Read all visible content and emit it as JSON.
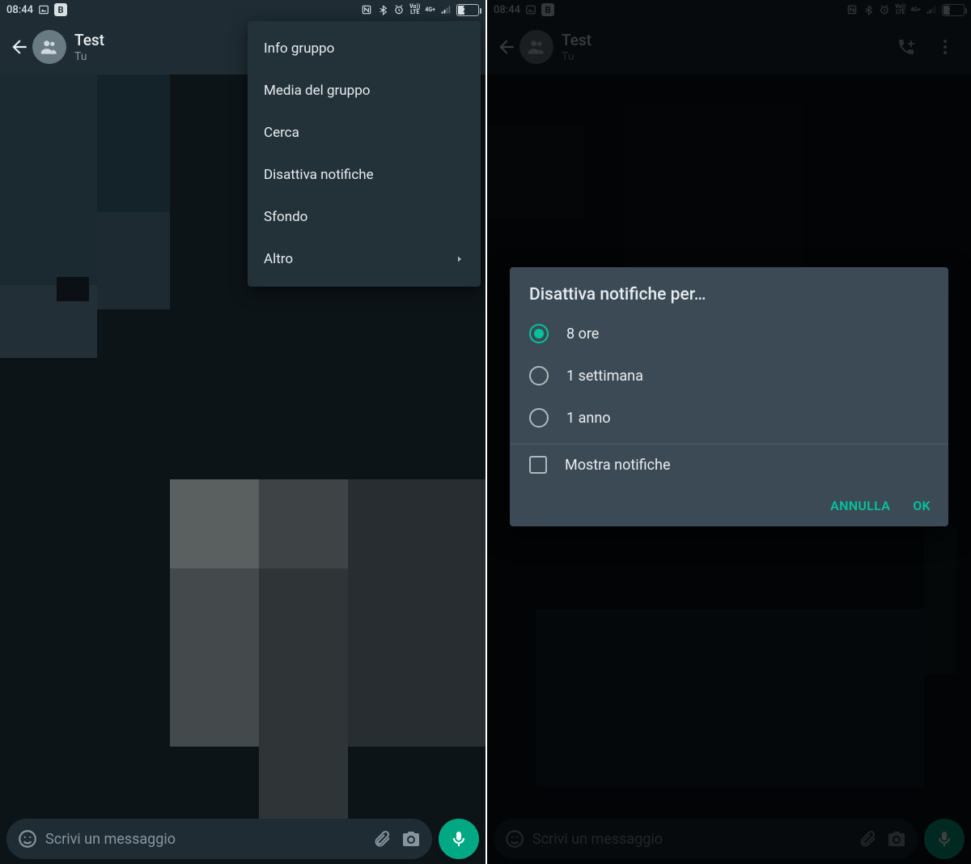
{
  "status": {
    "time": "08:44",
    "battery_text": "26",
    "net_small_1": "Vo))",
    "net_small_2": "LTE",
    "net_small_3": "4G+"
  },
  "chat": {
    "title": "Test",
    "subtitle": "Tu"
  },
  "composer": {
    "placeholder": "Scrivi un messaggio"
  },
  "menu": {
    "items": [
      {
        "label": "Info gruppo"
      },
      {
        "label": "Media del gruppo"
      },
      {
        "label": "Cerca"
      },
      {
        "label": "Disattiva notifiche"
      },
      {
        "label": "Sfondo"
      },
      {
        "label": "Altro",
        "submenu": true
      }
    ]
  },
  "dialog": {
    "title": "Disattiva notifiche per…",
    "options": [
      {
        "label": "8 ore",
        "selected": true
      },
      {
        "label": "1 settimana",
        "selected": false
      },
      {
        "label": "1 anno",
        "selected": false
      }
    ],
    "checkbox_label": "Mostra notifiche",
    "cancel": "ANNULLA",
    "ok": "OK"
  },
  "colors": {
    "accent": "#00a884",
    "accent_text": "#03c29e",
    "appbar": "#1f2c34",
    "panel": "#3b4a54",
    "bg": "#0d1418"
  }
}
